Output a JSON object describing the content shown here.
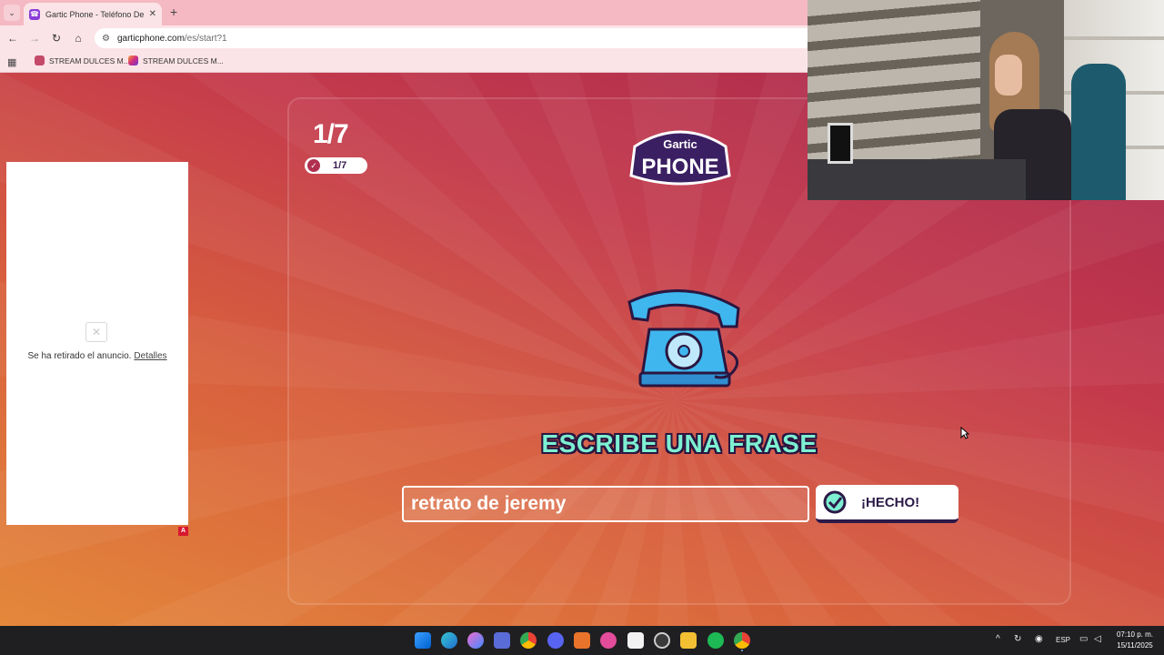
{
  "browser": {
    "tab_title": "Gartic Phone - Teléfono Descon",
    "tab_close": "✕",
    "new_tab": "+",
    "url_host": "garticphone.com",
    "url_path": "/es/start?1",
    "bookmarks": [
      "STREAM DULCES M...",
      "STREAM DULCES M..."
    ]
  },
  "ad": {
    "message": "Se ha retirado el anuncio.",
    "details_link": "Detalles",
    "badge": "A"
  },
  "game": {
    "round_big": "1/7",
    "round_done": "1/7",
    "logo_top": "Gartic",
    "logo_bottom": "PHONE",
    "prompt": "ESCRIBE UNA FRASE",
    "phrase_value": "retrato de jeremy",
    "done_button": "¡HECHO!",
    "colors": {
      "accent": "#7df0d2",
      "dark": "#2c1a48",
      "phone": "#3fb6ee"
    }
  },
  "taskbar": {
    "language": "ESP",
    "time": "07:10 p. m.",
    "date": "15/11/2025"
  }
}
